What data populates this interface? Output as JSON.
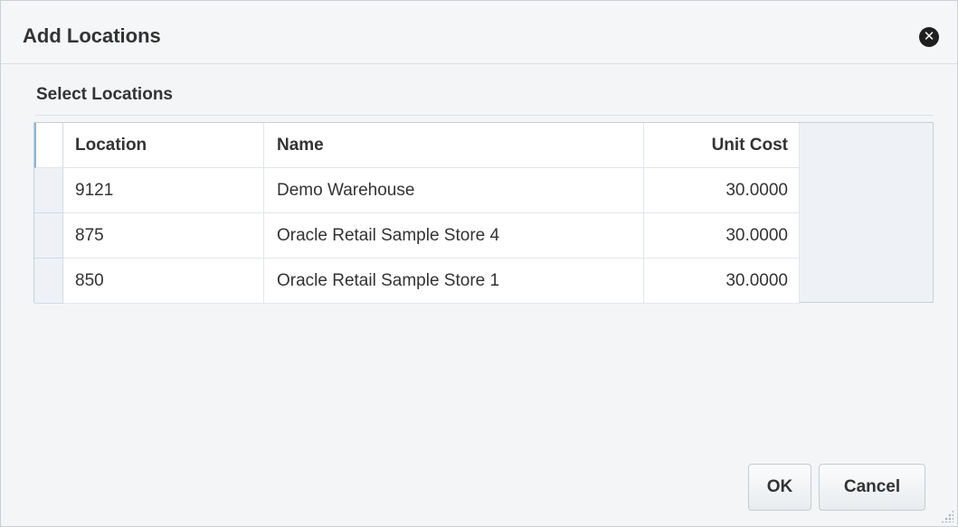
{
  "dialog": {
    "title": "Add Locations",
    "close_icon": "close-circle-icon"
  },
  "section": {
    "title": "Select Locations"
  },
  "table": {
    "columns": [
      "Location",
      "Name",
      "Unit Cost"
    ],
    "rows": [
      {
        "location": "9121",
        "name": "Demo Warehouse",
        "unit_cost": "30.0000"
      },
      {
        "location": "875",
        "name": "Oracle Retail Sample Store 4",
        "unit_cost": "30.0000"
      },
      {
        "location": "850",
        "name": "Oracle Retail Sample Store 1",
        "unit_cost": "30.0000"
      }
    ]
  },
  "buttons": {
    "ok": "OK",
    "cancel": "Cancel"
  },
  "colors": {
    "dialog_background": "#f3f5f7",
    "grid_border": "#c7d0d8",
    "header_accent": "#8fb3d9"
  }
}
